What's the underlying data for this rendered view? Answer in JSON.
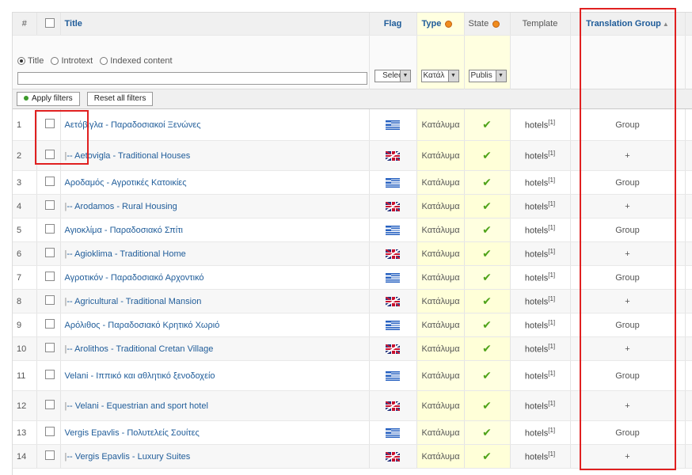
{
  "header": {
    "num": "#",
    "title": "Title",
    "flag": "Flag",
    "type": "Type",
    "state": "State",
    "template": "Template",
    "translation_group": "Translation Group"
  },
  "filters": {
    "radio_title": "Title",
    "radio_introtext": "Introtext",
    "radio_indexed": "Indexed content",
    "flag_select": "Select",
    "type_select": "Κατάλ",
    "state_select": "Publis",
    "apply_label": "Apply filters",
    "reset_label": "Reset all filters"
  },
  "rows": [
    {
      "num": "1",
      "title": "Αετόβιγλα - Παραδοσιακοί Ξενώνες",
      "tree": "",
      "lang": "greek-flag-icon",
      "type": "Κατάλυμα",
      "tmpl": "hotels",
      "sup": "[1]",
      "group": "Group"
    },
    {
      "num": "2",
      "title": "-- Aetovigla - Traditional Houses",
      "tree": "|",
      "lang": "uk-flag-icon",
      "type": "Κατάλυμα",
      "tmpl": "hotels",
      "sup": "[1]",
      "group": "+"
    },
    {
      "num": "3",
      "title": "Αροδαμός - Αγροτικές Κατοικίες",
      "tree": "",
      "lang": "greek-flag-icon",
      "type": "Κατάλυμα",
      "tmpl": "hotels",
      "sup": "[1]",
      "group": "Group"
    },
    {
      "num": "4",
      "title": "-- Arodamos - Rural Housing",
      "tree": "|",
      "lang": "uk-flag-icon",
      "type": "Κατάλυμα",
      "tmpl": "hotels",
      "sup": "[1]",
      "group": "+"
    },
    {
      "num": "5",
      "title": "Αγιοκλίμα - Παραδοσιακό Σπίτι",
      "tree": "",
      "lang": "greek-flag-icon",
      "type": "Κατάλυμα",
      "tmpl": "hotels",
      "sup": "[1]",
      "group": "Group"
    },
    {
      "num": "6",
      "title": "-- Agioklima - Traditional Home",
      "tree": "|",
      "lang": "uk-flag-icon",
      "type": "Κατάλυμα",
      "tmpl": "hotels",
      "sup": "[1]",
      "group": "+"
    },
    {
      "num": "7",
      "title": "Αγροτικόν - Παραδοσιακό Αρχοντικό",
      "tree": "",
      "lang": "greek-flag-icon",
      "type": "Κατάλυμα",
      "tmpl": "hotels",
      "sup": "[1]",
      "group": "Group"
    },
    {
      "num": "8",
      "title": "-- Agricultural - Traditional Mansion",
      "tree": "|",
      "lang": "uk-flag-icon",
      "type": "Κατάλυμα",
      "tmpl": "hotels",
      "sup": "[1]",
      "group": "+"
    },
    {
      "num": "9",
      "title": "Αρόλιθος - Παραδοσιακό Κρητικό Χωριό",
      "tree": "",
      "lang": "greek-flag-icon",
      "type": "Κατάλυμα",
      "tmpl": "hotels",
      "sup": "[1]",
      "group": "Group"
    },
    {
      "num": "10",
      "title": "-- Arolithos - Traditional Cretan Village",
      "tree": "|",
      "lang": "uk-flag-icon",
      "type": "Κατάλυμα",
      "tmpl": "hotels",
      "sup": "[1]",
      "group": "+"
    },
    {
      "num": "11",
      "title": "Velani - Ιππικό και αθλητικό ξενοδοχείο",
      "tree": "",
      "lang": "greek-flag-icon",
      "type": "Κατάλυμα",
      "tmpl": "hotels",
      "sup": "[1]",
      "group": "Group"
    },
    {
      "num": "12",
      "title": "-- Velani - Equestrian and sport hotel",
      "tree": "|",
      "lang": "uk-flag-icon",
      "type": "Κατάλυμα",
      "tmpl": "hotels",
      "sup": "[1]",
      "group": "+"
    },
    {
      "num": "13",
      "title": "Vergis Epavlis - Πολυτελείς Σουίτες",
      "tree": "",
      "lang": "greek-flag-icon",
      "type": "Κατάλυμα",
      "tmpl": "hotels",
      "sup": "[1]",
      "group": "Group"
    },
    {
      "num": "14",
      "title": "-- Vergis Epavlis - Luxury Suites",
      "tree": "|",
      "lang": "uk-flag-icon",
      "type": "Κατάλυμα",
      "tmpl": "hotels",
      "sup": "[1]",
      "group": "+"
    }
  ],
  "colors": {
    "highlight_box": "#e02020",
    "link": "#1f5c99",
    "check": "#4fa31a"
  }
}
